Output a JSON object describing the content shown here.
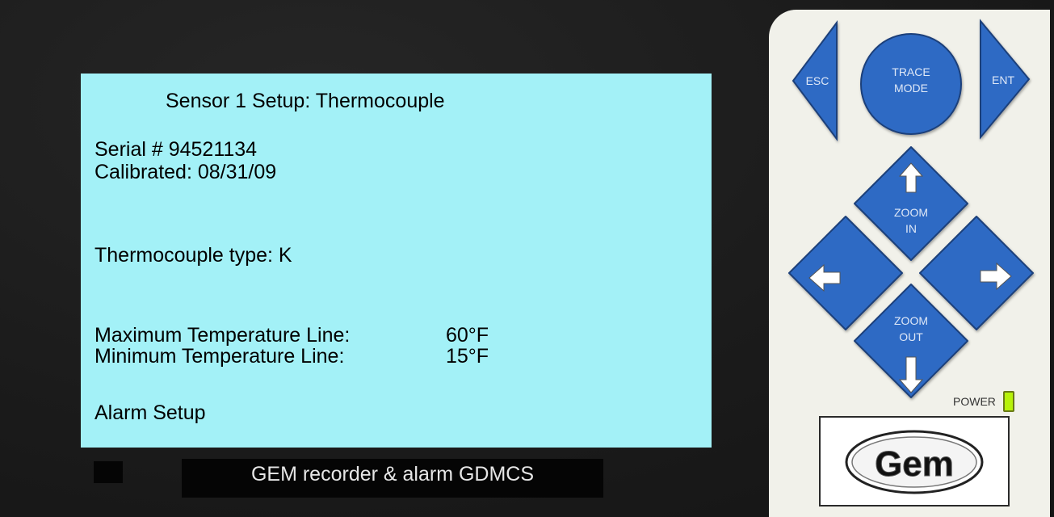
{
  "screen": {
    "title": "Sensor 1 Setup:   Thermocouple",
    "serial": "Serial # 94521134",
    "calibrated": "Calibrated:  08/31/09",
    "thermocouple_type": "Thermocouple type:  K",
    "max_temp_label": "Maximum Temperature Line:",
    "max_temp_value": "60°F",
    "min_temp_label": "Minimum Temperature Line:",
    "min_temp_value": "15°F",
    "alarm_setup": "Alarm Setup"
  },
  "footer": {
    "label": "GEM recorder & alarm GDMCS"
  },
  "keypad": {
    "esc": "ESC",
    "trace_line1": "TRACE",
    "trace_line2": "MODE",
    "ent": "ENT",
    "zoom_in_line1": "ZOOM",
    "zoom_in_line2": "IN",
    "zoom_out_line1": "ZOOM",
    "zoom_out_line2": "OUT",
    "power": "POWER",
    "logo": "Gem"
  },
  "colors": {
    "screen_bg": "#a3f1f7",
    "key_blue": "#2d6bc4",
    "panel_bg": "#f1f1ea",
    "power_led": "#b7f20b"
  },
  "icons": [
    "arrow-up-icon",
    "arrow-down-icon",
    "arrow-left-icon",
    "arrow-right-icon"
  ]
}
